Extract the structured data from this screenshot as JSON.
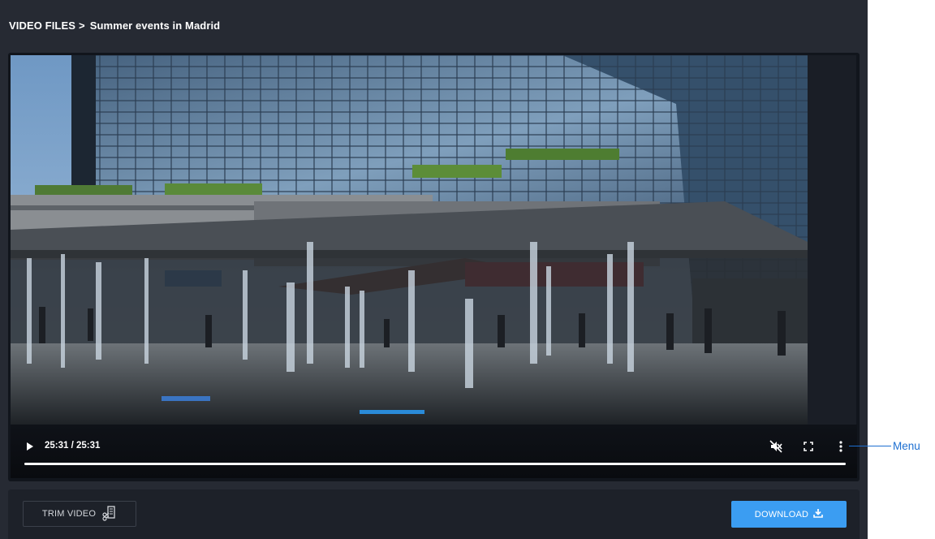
{
  "breadcrumb": {
    "root": "VIDEO FILES",
    "separator": ">",
    "current": "Summer events in Madrid"
  },
  "player": {
    "time_display": "25:31 / 25:31",
    "progress_fraction": 1.0,
    "icons": {
      "play": "play-icon",
      "mute": "volume-muted-icon",
      "fullscreen": "fullscreen-icon",
      "menu": "more-vertical-icon"
    }
  },
  "actions": {
    "trim_label": "TRIM VIDEO",
    "download_label": "DOWNLOAD"
  },
  "annotation": {
    "menu_label": "Menu"
  },
  "colors": {
    "app_bg": "#262a33",
    "accent": "#3b9df2",
    "annotation": "#1d6fd1"
  }
}
